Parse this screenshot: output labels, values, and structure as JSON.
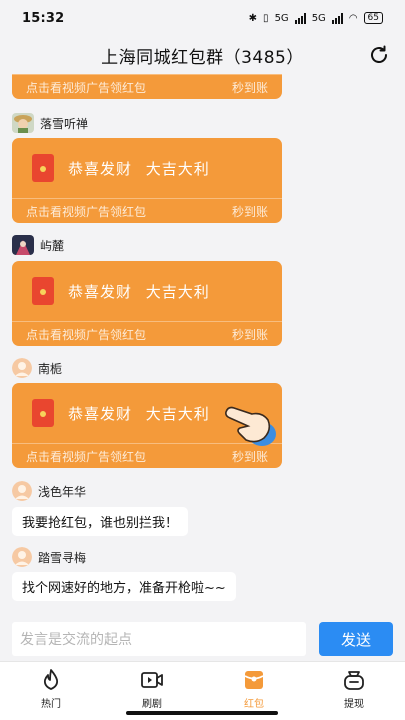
{
  "status": {
    "time": "15:32",
    "network_a": "5G",
    "network_b": "5G",
    "battery": "65"
  },
  "header": {
    "title": "上海同城红包群（3485）",
    "refresh_icon": "refresh-icon"
  },
  "red_packet": {
    "message": "恭喜发财  大吉大利",
    "cta": "点击看视频广告领红包",
    "tag": "秒到账",
    "color": "#f49a3a"
  },
  "messages": [
    {
      "sender": "落雪听禅"
    },
    {
      "sender": "屿麓"
    },
    {
      "sender": "南栀"
    },
    {
      "sender": "浅色年华",
      "text": "我要抢红包，谁也别拦我！"
    },
    {
      "sender": "踏雪寻梅",
      "text": "找个网速好的地方，准备开枪啦~~"
    }
  ],
  "input": {
    "placeholder": "发言是交流的起点",
    "send_label": "发送"
  },
  "tabs": [
    {
      "label": "热门",
      "icon": "flame-icon",
      "active": false
    },
    {
      "label": "刷剧",
      "icon": "video-icon",
      "active": false
    },
    {
      "label": "红包",
      "icon": "red-envelope-icon",
      "active": true
    },
    {
      "label": "提现",
      "icon": "wallet-icon",
      "active": false
    }
  ],
  "accent": "#2b8cf3"
}
